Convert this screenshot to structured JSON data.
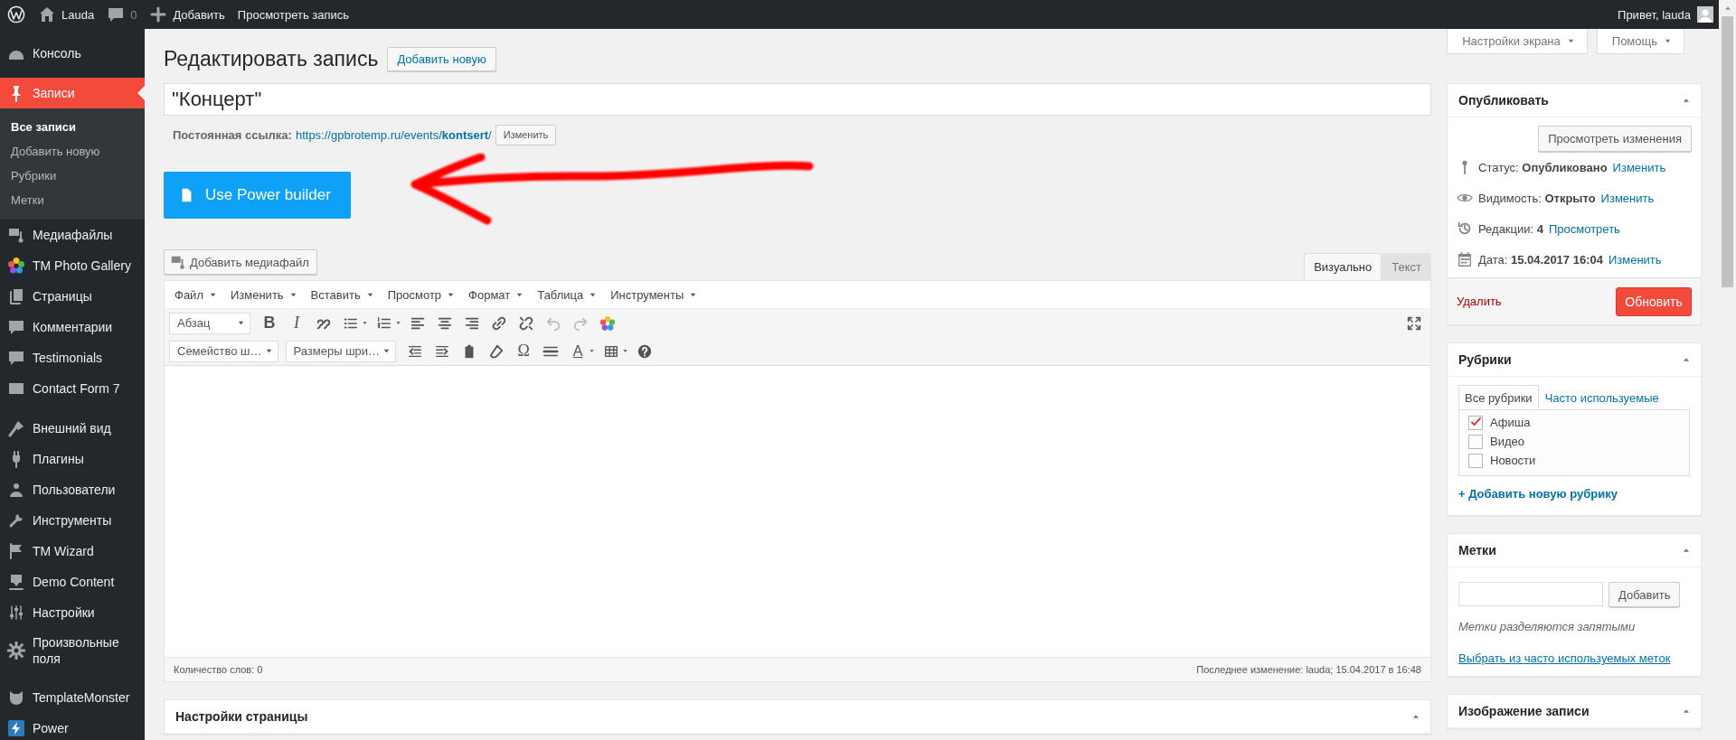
{
  "admin_bar": {
    "site": "Lauda",
    "comments": "0",
    "new": "Добавить",
    "view": "Просмотреть запись",
    "greeting": "Привет, lauda"
  },
  "sidebar": {
    "groups": [
      [
        {
          "label": "Консоль",
          "selected": false
        },
        {
          "label": "Записи",
          "selected": true,
          "children": [
            {
              "label": "Все записи",
              "selected": true
            },
            {
              "label": "Добавить новую",
              "selected": false
            },
            {
              "label": "Рубрики",
              "selected": false
            },
            {
              "label": "Метки",
              "selected": false
            }
          ]
        },
        {
          "label": "Медиафайлы",
          "selected": false
        },
        {
          "label": "TM Photo Gallery",
          "selected": false
        },
        {
          "label": "Страницы",
          "selected": false
        },
        {
          "label": "Комментарии",
          "selected": false
        },
        {
          "label": "Testimonials",
          "selected": false
        },
        {
          "label": "Contact Form 7",
          "selected": false
        }
      ],
      [
        {
          "label": "Внешний вид",
          "selected": false
        },
        {
          "label": "Плагины",
          "selected": false
        },
        {
          "label": "Пользователи",
          "selected": false
        },
        {
          "label": "Инструменты",
          "selected": false
        },
        {
          "label": "TM Wizard",
          "selected": false
        },
        {
          "label": "Demo Content",
          "selected": false
        },
        {
          "label": "Настройки",
          "selected": false
        },
        {
          "label": "Произвольные поля",
          "selected": false
        }
      ],
      [
        {
          "label": "TemplateMonster",
          "selected": false
        },
        {
          "label": "Power",
          "selected": false
        }
      ]
    ]
  },
  "screen_meta": [
    "Настройки экрана",
    "Помощь"
  ],
  "header": {
    "title": "Редактировать запись",
    "add_new": "Добавить новую"
  },
  "post_title": {
    "value": "\"Концерт\""
  },
  "permalink": {
    "label": "Постоянная ссылка:",
    "url": "https://gpbrotemp.ru/events/**kontsert**/",
    "edit": "Изменить"
  },
  "power_builder": {
    "label": "Use Power builder"
  },
  "editor": {
    "add_media": "Добавить медиафайл",
    "tabs": [
      {
        "label": "Визуально",
        "selected": true
      },
      {
        "label": "Текст",
        "selected": false
      }
    ],
    "menu": [
      "Файл",
      "Изменить",
      "Вставить",
      "Просмотр",
      "Формат",
      "Таблица",
      "Инструменты"
    ],
    "toolbar": {
      "format_select": "Абзац",
      "bold": "B",
      "italic": "I",
      "font_family": "Семейство ш…",
      "font_size": "Размеры шри…",
      "special_char": "Ω",
      "text_color": "A"
    },
    "word_count": "Количество слов: 0",
    "last_edit": "Последнее изменение: lauda; 15.04.2017 в 16:48"
  },
  "page_settings": {
    "title": "Настройки страницы"
  },
  "publish": {
    "title": "Опубликовать",
    "preview": "Просмотреть изменения",
    "rows": [
      {
        "text": "Статус: **Опубликовано**",
        "link": "Изменить"
      },
      {
        "text": "Видимость: **Открыто**",
        "link": "Изменить"
      },
      {
        "text": "Редакции: **4**",
        "link": "Просмотреть"
      },
      {
        "text": "Дата: **15.04.2017 16:04**",
        "link": "Изменить"
      }
    ],
    "delete": "Удалить",
    "update": "Обновить"
  },
  "categories": {
    "title": "Рубрики",
    "tabs": [
      {
        "label": "Все рубрики",
        "selected": true
      },
      {
        "label": "Часто используемые",
        "selected": false
      }
    ],
    "items": [
      {
        "label": "Афиша",
        "checked": true
      },
      {
        "label": "Видео",
        "checked": false
      },
      {
        "label": "Новости",
        "checked": false
      }
    ],
    "add": "+ Добавить новую рубрику"
  },
  "tags": {
    "title": "Метки",
    "add": "Добавить",
    "hint": "Метки разделяются запятыми",
    "choose": "Выбрать из часто используемых меток"
  },
  "featured_image": {
    "title": "Изображение записи"
  }
}
